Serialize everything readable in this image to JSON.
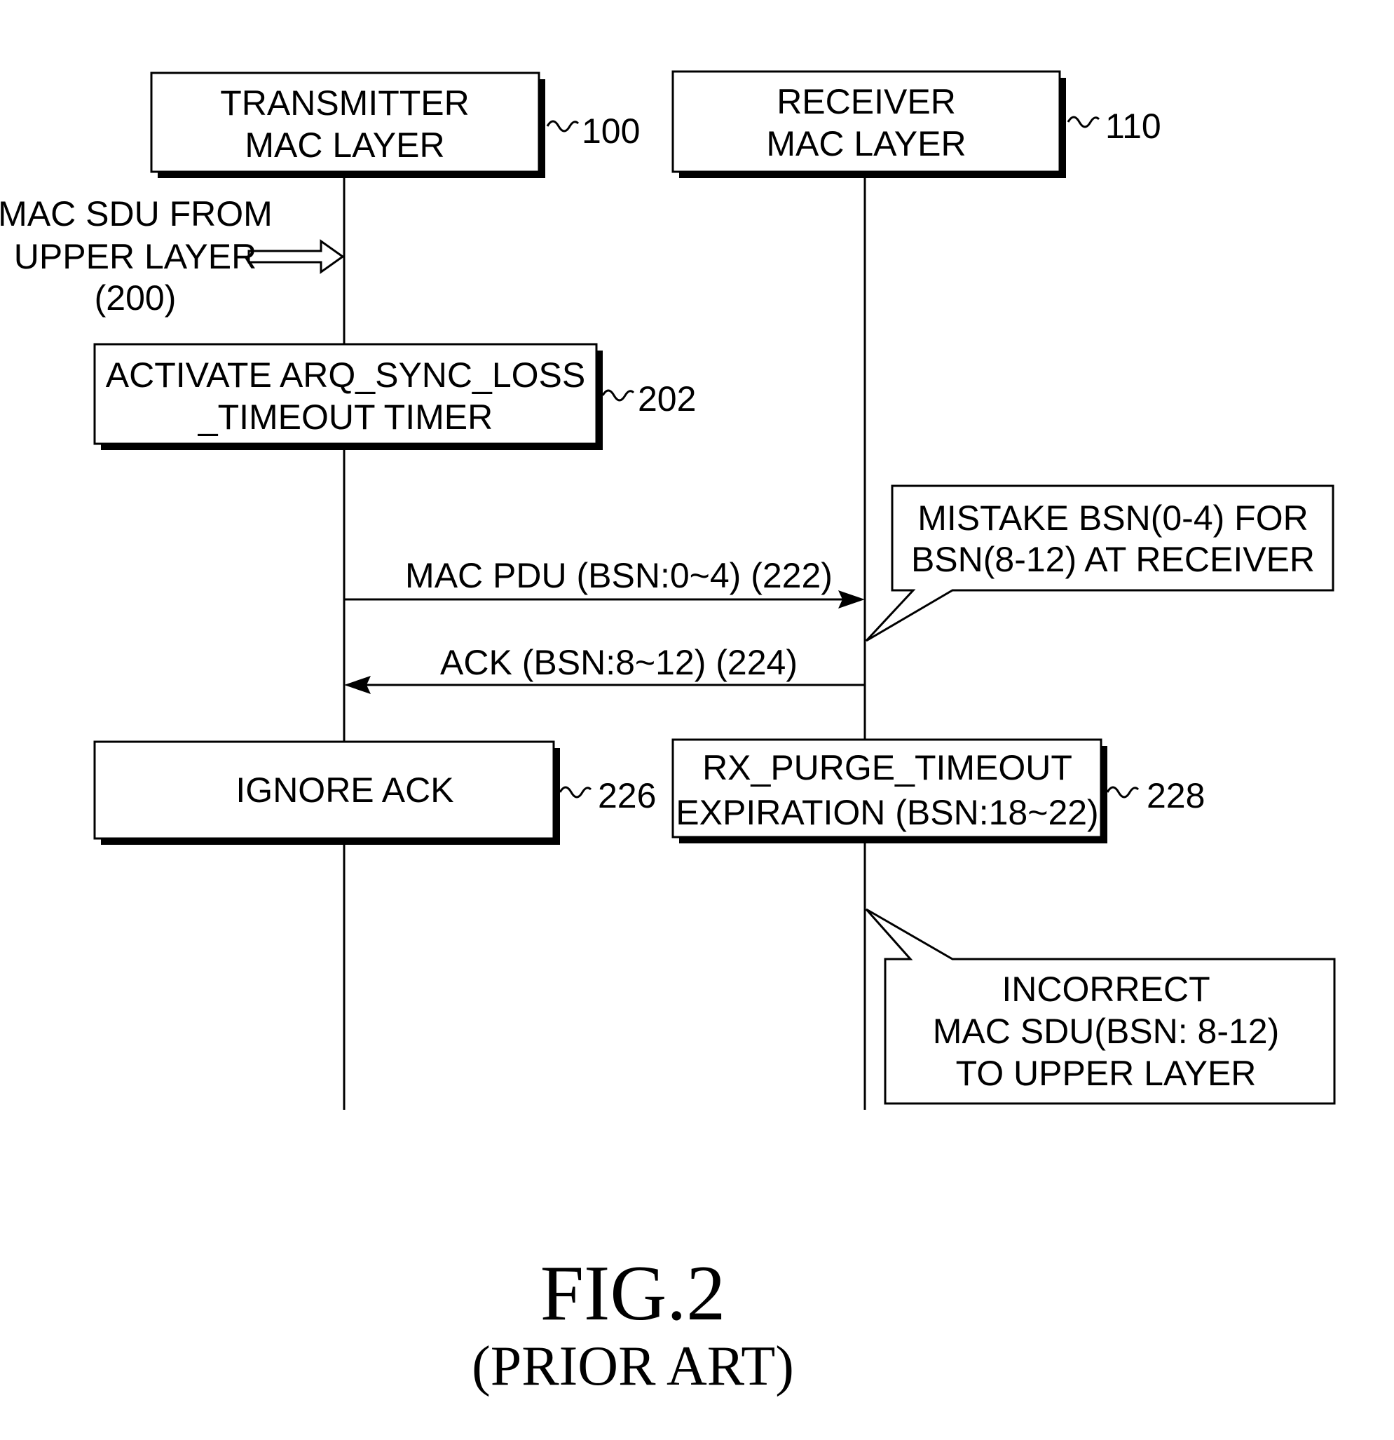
{
  "figure": {
    "title": "FIG.2",
    "subtitle": "(PRIOR ART)"
  },
  "entities": [
    {
      "id": "transmitter",
      "lines": [
        "TRANSMITTER",
        "MAC LAYER"
      ],
      "ref": "100"
    },
    {
      "id": "receiver",
      "lines": [
        "RECEIVER",
        "MAC LAYER"
      ],
      "ref": "110"
    }
  ],
  "input_label": {
    "lines": [
      "MAC SDU FROM",
      "UPPER LAYER",
      "(200)"
    ],
    "icon": "hollow-arrow-right"
  },
  "steps": [
    {
      "id": "202",
      "lines": [
        "ACTIVATE ARQ_SYNC_LOSS",
        "_TIMEOUT TIMER"
      ],
      "ref": "202"
    },
    {
      "id": "226",
      "lines": [
        "IGNORE ACK"
      ],
      "ref": "226"
    },
    {
      "id": "228",
      "lines": [
        "RX_PURGE_TIMEOUT",
        "EXPIRATION (BSN:18~22)"
      ],
      "ref": "228"
    }
  ],
  "messages": [
    {
      "label": "MAC PDU (BSN:0~4) (222)",
      "from": "transmitter",
      "to": "receiver"
    },
    {
      "label": "ACK (BSN:8~12) (224)",
      "from": "receiver",
      "to": "transmitter"
    }
  ],
  "callouts": [
    {
      "lines": [
        "MISTAKE BSN(0-4) FOR",
        "BSN(8-12) AT RECEIVER"
      ]
    },
    {
      "lines": [
        "INCORRECT",
        "MAC SDU(BSN: 8-12)",
        "TO UPPER LAYER"
      ]
    }
  ]
}
